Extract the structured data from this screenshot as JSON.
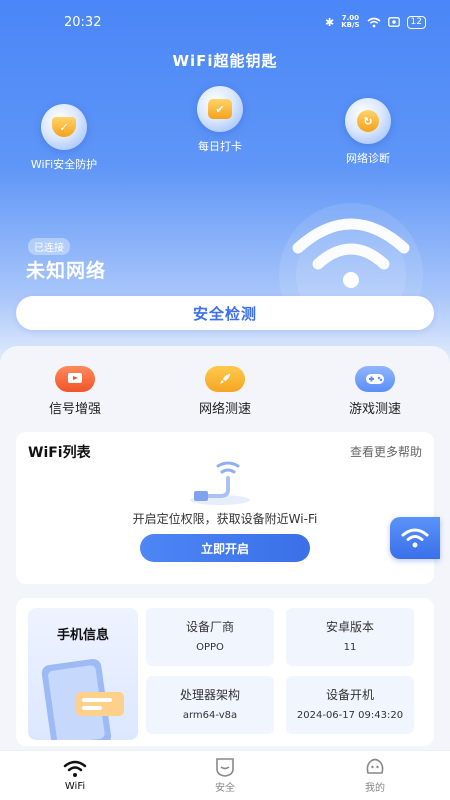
{
  "status_bar": {
    "time": "20:32",
    "net_speed_value": "7.00",
    "net_speed_unit": "KB/S",
    "battery": "12"
  },
  "app": {
    "title": "WiFi超能钥匙"
  },
  "features": [
    {
      "label": "WiFi安全防护",
      "icon": "shield-icon"
    },
    {
      "label": "每日打卡",
      "icon": "checkin-icon"
    },
    {
      "label": "网络诊断",
      "icon": "diagnose-icon"
    }
  ],
  "network": {
    "status_badge": "已连接",
    "name": "未知网络"
  },
  "check_button": "安全检测",
  "tools": [
    {
      "label": "信号增强",
      "icon": "signal-boost-icon",
      "color": "#f26b3a"
    },
    {
      "label": "网络测速",
      "icon": "rocket-icon",
      "color": "#f5a623"
    },
    {
      "label": "游戏测速",
      "icon": "gamepad-icon",
      "color": "#5b8ff5"
    }
  ],
  "wifi_list": {
    "title": "WiFi列表",
    "help_link": "查看更多帮助",
    "locate_text": "开启定位权限，获取设备附近Wi-Fi",
    "open_button": "立即开启"
  },
  "phone_info": {
    "title": "手机信息",
    "cells": [
      {
        "label": "设备厂商",
        "value": "OPPO"
      },
      {
        "label": "安卓版本",
        "value": "11"
      },
      {
        "label": "处理器架构",
        "value": "arm64-v8a"
      },
      {
        "label": "设备开机",
        "value": "2024-06-17 09:43:20"
      }
    ]
  },
  "tabs": [
    {
      "label": "WiFi",
      "icon": "wifi-icon",
      "active": true
    },
    {
      "label": "安全",
      "icon": "shield-icon",
      "active": false
    },
    {
      "label": "我的",
      "icon": "profile-icon",
      "active": false
    }
  ],
  "colors": {
    "primary": "#3d6ff0",
    "hero_top": "#4a86f7",
    "background": "#f3f5fa"
  }
}
